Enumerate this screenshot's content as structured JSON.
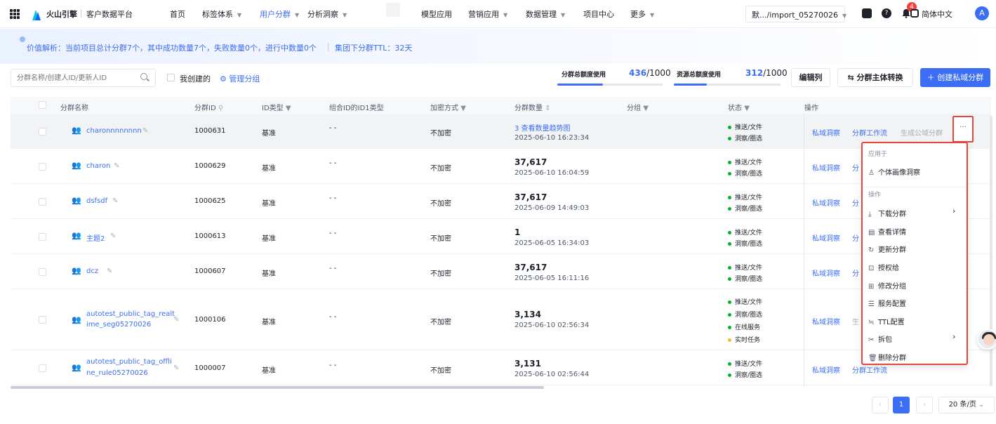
{
  "nav": {
    "brand": "火山引擎",
    "platform": "客户数据平台",
    "items": [
      {
        "label": "首页",
        "caret": ""
      },
      {
        "label": "标签体系",
        "caret": "▼"
      },
      {
        "label": "用户分群",
        "caret": "▼"
      },
      {
        "label": "分析洞察",
        "caret": "▼"
      },
      {
        "label": "模型应用",
        "caret": ""
      },
      {
        "label": "营销应用",
        "caret": "▼"
      },
      {
        "label": "数据管理",
        "caret": "▼"
      },
      {
        "label": "项目中心",
        "caret": ""
      },
      {
        "label": "更多",
        "caret": "▼"
      }
    ],
    "project": "默.../import_05270026",
    "project_caret": "▼",
    "notification_count": "4",
    "language": "简体中文",
    "avatar": "A"
  },
  "banner": {
    "text": "价值解析：当前项目总计分群7个，其中成功数量7个，失败数量0个，进行中数量0个",
    "ttl": "集团下分群TTL：32天"
  },
  "toolbar": {
    "search_placeholder": "分群名称/创建人ID/更新人ID",
    "mine_label": "我创建的",
    "manage_label": "管理分组",
    "quota1_label": "分群总额度使用",
    "quota1_used": "436",
    "quota1_total": "/1000",
    "quota1_fraction": 0.436,
    "quota2_label": "资源总额度使用",
    "quota2_used": "312",
    "quota2_total": "/1000",
    "quota2_fraction": 0.312,
    "edit_columns": "编辑列",
    "switch_subject": "分群主体转换",
    "create": "＋ 创建私域分群"
  },
  "table": {
    "headers": {
      "name": "分群名称",
      "id": "分群ID",
      "idtype": "ID类型",
      "combo": "组合ID的ID1类型",
      "encrypt": "加密方式",
      "count": "分群数量",
      "group": "分组",
      "status": "状态",
      "ops": "操作"
    },
    "rows": [
      {
        "name": "charonnnnnnnn",
        "id": "1000631",
        "idtype": "基准",
        "combo": "- -",
        "encrypt": "不加密",
        "count": "3  查看数量趋势图",
        "date": "2025-06-10 16:23:34",
        "status": [
          "推送/文件",
          "洞察/圈选"
        ]
      },
      {
        "name": "charon",
        "id": "1000629",
        "idtype": "基准",
        "combo": "- -",
        "encrypt": "不加密",
        "count": "37,617",
        "date": "2025-06-10 16:04:59",
        "status": [
          "推送/文件",
          "洞察/圈选"
        ]
      },
      {
        "name": "dsfsdf",
        "id": "1000625",
        "idtype": "基准",
        "combo": "- -",
        "encrypt": "不加密",
        "count": "37,617",
        "date": "2025-06-09 14:49:03",
        "status": [
          "推送/文件",
          "洞察/圈选"
        ]
      },
      {
        "name": "主题2",
        "id": "1000613",
        "idtype": "基准",
        "combo": "- -",
        "encrypt": "不加密",
        "count": "1",
        "date": "2025-06-05 16:34:03",
        "status": [
          "推送/文件",
          "洞察/圈选"
        ]
      },
      {
        "name": "dcz",
        "id": "1000607",
        "idtype": "基准",
        "combo": "- -",
        "encrypt": "不加密",
        "count": "37,617",
        "date": "2025-06-05 16:11:16",
        "status": [
          "推送/文件",
          "洞察/圈选"
        ]
      },
      {
        "name_line1": "autotest_public_tag_realt",
        "name_line2": "ime_seg05270026",
        "id": "1000106",
        "idtype": "基准",
        "combo": "- -",
        "encrypt": "不加密",
        "count": "3,134",
        "date": "2025-06-10 02:56:34",
        "status": [
          "推送/文件",
          "洞察/圈选",
          "在线服务",
          "实时任务"
        ]
      },
      {
        "name_line1": "autotest_public_tag_offli",
        "name_line2": "ne_rule05270026",
        "id": "1000007",
        "idtype": "基准",
        "combo": "- -",
        "encrypt": "不加密",
        "count": "3,131",
        "date": "2025-06-10 02:56:44",
        "status": [
          "推送/文件",
          "洞察/圈选"
        ]
      }
    ],
    "ops": {
      "insight": "私域洞察",
      "workflow": "分群工作流",
      "workflow_short": "分",
      "workflow_short_row6": "生",
      "workflow_row7": "分群工作流",
      "public": "生成公域分群",
      "more": "···"
    }
  },
  "menu": {
    "section1": "应用于",
    "item_portrait": "个体画像洞察",
    "section2": "操作",
    "items": [
      "下载分群",
      "查看详情",
      "更新分群",
      "授权给",
      "修改分组",
      "服务配置",
      "TTL配置",
      "拆包",
      "删除分群"
    ],
    "arrow": "›"
  },
  "pagination": {
    "prev": "‹",
    "current": "1",
    "next": "›",
    "page_size": "20 条/页"
  },
  "colors": {
    "accent": "#3b6ef5",
    "highlight": "#e8453c",
    "success": "#00b42a",
    "warning": "#f7ba1e"
  }
}
